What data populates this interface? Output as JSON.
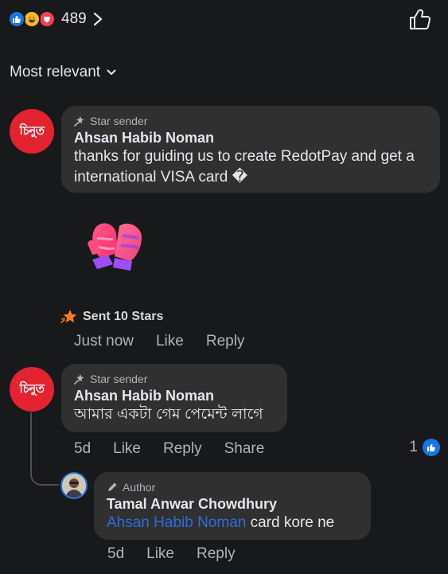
{
  "header": {
    "reactions_total": "489",
    "icons": [
      "like-reaction-icon",
      "haha-reaction-icon",
      "love-reaction-icon"
    ]
  },
  "sort": {
    "label": "Most relevant"
  },
  "comments": [
    {
      "avatar_text": "চিনুত",
      "badge": "Star sender",
      "author": "Ahsan Habib Noman",
      "text": "thanks for guiding us to create RedotPay and get a international VISA card �",
      "stars_sent": "Sent 10 Stars",
      "time": "Just now",
      "like": "Like",
      "reply": "Reply"
    },
    {
      "avatar_text": "চিনুত",
      "badge": "Star sender",
      "author": "Ahsan Habib Noman",
      "text": "আমার একটা গেম পেমেন্ট লাগে",
      "time": "5d",
      "like": "Like",
      "reply": "Reply",
      "share": "Share",
      "reaction_count": "1"
    }
  ],
  "reply": {
    "badge": "Author",
    "author": "Tamal Anwar Chowdhury",
    "mention": "Ahsan Habib Noman",
    "text": " card kore ne",
    "time": "5d",
    "like": "Like",
    "reply": "Reply"
  },
  "colors": {
    "background": "#18191a",
    "bubble": "#303031",
    "accent": "#1b74e4",
    "brand_red": "#e3232f"
  }
}
